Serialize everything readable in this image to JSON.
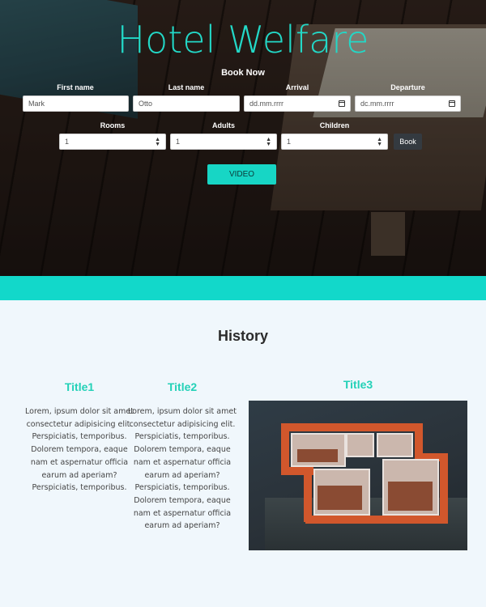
{
  "hero": {
    "title": "Hotel Welfare",
    "book_now": "Book Now"
  },
  "form": {
    "first_name": {
      "label": "First name",
      "value": "Mark"
    },
    "last_name": {
      "label": "Last name",
      "value": "Otto"
    },
    "arrival": {
      "label": "Arrival",
      "value": "dd.mm.rrrr"
    },
    "departure": {
      "label": "Departure",
      "value": "dc.mm.rrrr"
    },
    "rooms": {
      "label": "Rooms",
      "value": "1"
    },
    "adults": {
      "label": "Adults",
      "value": "1"
    },
    "children": {
      "label": "Children",
      "value": "1"
    },
    "book_label": "Book"
  },
  "video_button": "VIDEO",
  "history": {
    "title": "History",
    "columns": [
      {
        "title": "Title1",
        "text": "Lorem, ipsum dolor sit amet consectetur adipisicing elit. Perspiciatis, temporibus. Dolorem tempora, eaque nam et aspernatur officia earum ad aperiam? Perspiciatis, temporibus."
      },
      {
        "title": "Title2",
        "text": "Lorem, ipsum dolor sit amet consectetur adipisicing elit. Perspiciatis, temporibus. Dolorem tempora, eaque nam et aspernatur officia earum ad aperiam? Perspiciatis, temporibus. Dolorem tempora, eaque nam et aspernatur officia earum ad aperiam?"
      },
      {
        "title": "Title3"
      }
    ]
  },
  "colors": {
    "accent": "#17d6c5",
    "band": "#12d8ca",
    "button_dark": "#343a40",
    "page_bg": "#f0f7fc"
  },
  "icons": {
    "date": "calendar-icon",
    "select": "select-arrows-icon"
  }
}
